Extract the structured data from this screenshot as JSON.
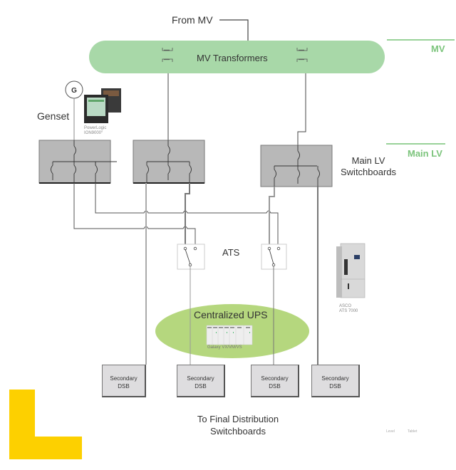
{
  "diagram": {
    "source_label": "From MV",
    "mv_block_label": "MV Transformers",
    "levels": {
      "mv": "MV",
      "main_lv": "Main LV"
    },
    "genset": {
      "label": "Genset",
      "symbol": "G",
      "meter_caption_line1": "PowerLogic",
      "meter_caption_line2": "ION9000°"
    },
    "main_lv_switchboards_label_line1": "Main LV",
    "main_lv_switchboards_label_line2": "Switchboards",
    "ats": {
      "label": "ATS",
      "product_caption_line1": "ASCO",
      "product_caption_line2": "ATS 7000"
    },
    "ups": {
      "label": "Centralized UPS",
      "product_caption": "Galaxy VX/VM/VS"
    },
    "secondary_boards": [
      {
        "line1": "Secondary",
        "line2": "DSB"
      },
      {
        "line1": "Secondary",
        "line2": "DSB"
      },
      {
        "line1": "Secondary",
        "line2": "DSB"
      },
      {
        "line1": "Secondary",
        "line2": "DSB"
      }
    ],
    "final_label_line1": "To Final Distribution",
    "final_label_line2": "Switchboards",
    "footer_notes": [
      "Level",
      "Tablet"
    ],
    "colors": {
      "mv_green": "#a8d8a8",
      "ups_green": "#b5d77e",
      "level_green": "#7cc47c",
      "switchboard_gray": "#b8b8b8",
      "secondary_gray": "#dedddf",
      "brand_yellow": "#fdd000"
    }
  }
}
